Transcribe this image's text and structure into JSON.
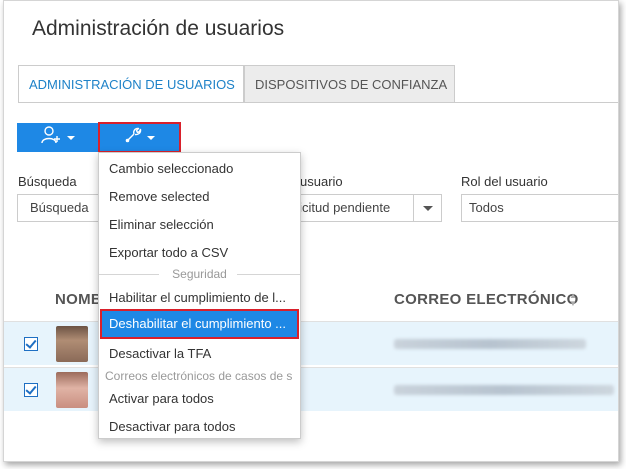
{
  "page": {
    "title": "Administración de usuarios"
  },
  "tabs": [
    {
      "label": "ADMINISTRACIÓN DE USUARIOS",
      "active": true
    },
    {
      "label": "DISPOSITIVOS DE CONFIANZA",
      "active": false
    }
  ],
  "toolbar": {
    "add_user_icon": "user-plus-icon",
    "tools_icon": "wrench-icon"
  },
  "filters": {
    "search_label": "Búsqueda",
    "search_placeholder": "Búsqueda",
    "status_label": "usuario",
    "status_value": "plicitud pendiente",
    "role_label": "Rol del usuario",
    "role_value": "Todos"
  },
  "table": {
    "col_name": "NOMB",
    "col_email": "CORREO ELECTRÓNICO",
    "rows": [
      {
        "checked": true
      },
      {
        "checked": true
      }
    ]
  },
  "menu": {
    "items": [
      "Cambio seleccionado",
      "Remove selected",
      "Eliminar selección",
      "Exportar todo a CSV"
    ],
    "section_security": "Seguridad",
    "security_items": [
      "Habilitar el cumplimiento de l...",
      "Deshabilitar el cumplimiento ...",
      "Desactivar la TFA"
    ],
    "section_cases": "Correos electrónicos de casos de s",
    "case_items": [
      "Activar para todos",
      "Desactivar para todos"
    ]
  },
  "colors": {
    "accent": "#1e88e5",
    "highlight_border": "#d9202b",
    "row_selected": "#e7f4fc"
  }
}
